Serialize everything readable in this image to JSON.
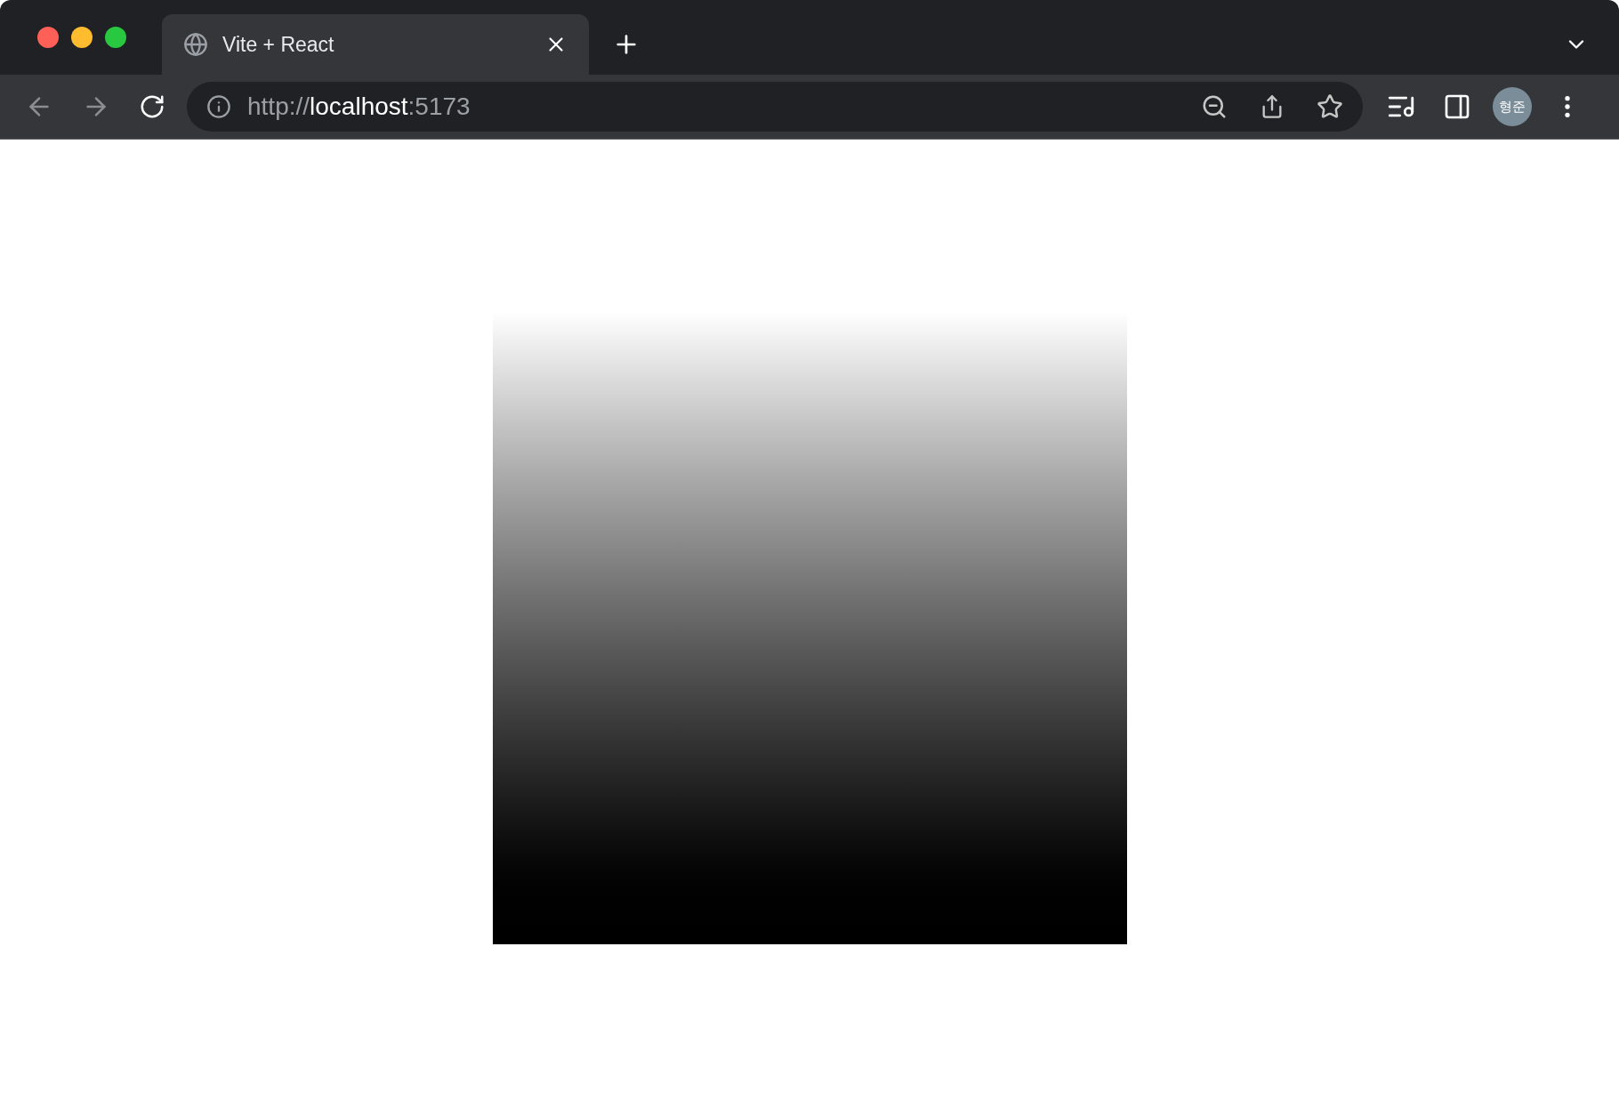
{
  "tabs": [
    {
      "title": "Vite + React",
      "selected": true
    }
  ],
  "address_bar": {
    "scheme": "http://",
    "host": "localhost",
    "port": ":5173"
  },
  "profile": {
    "initials": "형준"
  }
}
